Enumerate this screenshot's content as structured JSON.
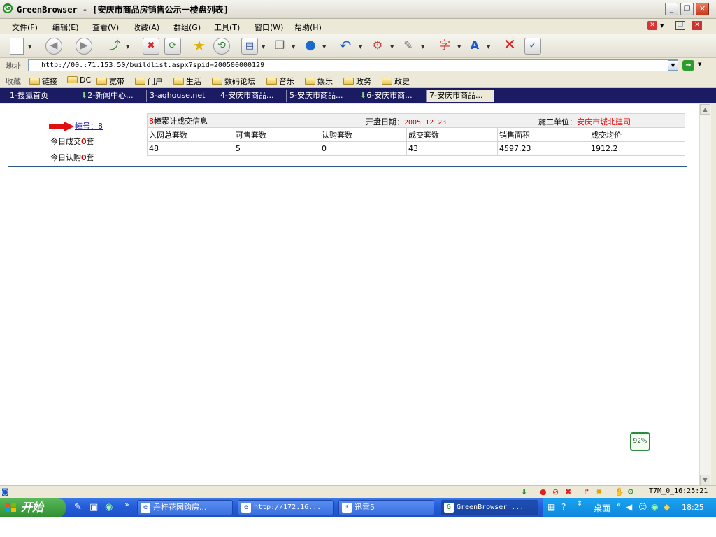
{
  "window": {
    "title": "GreenBrowser - [安庆市商品房销售公示一楼盘列表]"
  },
  "menu": {
    "items": [
      "文件(F)",
      "编辑(E)",
      "查看(V)",
      "收藏(A)",
      "群组(G)",
      "工具(T)",
      "窗口(W)",
      "帮助(H)"
    ]
  },
  "address": {
    "label": "地址",
    "url": "http://00.:71.153.50/buildlist.aspx?spid=200500000129"
  },
  "favorites": {
    "label": "收藏",
    "items": [
      "链接",
      "DC",
      "宽带",
      "门户",
      "生活",
      "数码论坛",
      "音乐",
      "娱乐",
      "政务",
      "政史"
    ]
  },
  "tabs": [
    {
      "label": "1-搜狐首页",
      "download": false
    },
    {
      "label": "2-新闻中心...",
      "download": true
    },
    {
      "label": "3-aqhouse.net",
      "download": false
    },
    {
      "label": "4-安庆市商品...",
      "download": false
    },
    {
      "label": "5-安庆市商品...",
      "download": false
    },
    {
      "label": "6-安庆市商...",
      "download": true
    },
    {
      "label": "7-安庆市商品...",
      "download": false
    }
  ],
  "listing": {
    "building_link": "幢号：8",
    "today_deal_prefix": "今日成交",
    "today_deal_count": "0",
    "today_sub_prefix": "今日认购",
    "today_sub_count": "0",
    "unit": "套",
    "info_num": "8",
    "info_title": "幢累计成交信息",
    "open_date_label": "开盘日期：",
    "open_date": "2005 12 23",
    "builder_label": "施工单位：",
    "builder": "安庆市城北建司",
    "columns": [
      "入网总套数",
      "可售套数",
      "认购套数",
      "成交套数",
      "销售面积",
      "成交均价"
    ],
    "values": [
      "48",
      "5",
      "0",
      "43",
      "4597.23",
      "1912.2"
    ]
  },
  "zoom": {
    "label": "92%"
  },
  "status": {
    "readout": "T7M_0_16:25:21"
  },
  "taskbar": {
    "start_label": "开始",
    "tasks": [
      "丹桂花园购房...",
      "http://172.16...",
      "迅雷5",
      "GreenBrowser ..."
    ],
    "tray_desktop": "桌面",
    "clock": "18:25"
  },
  "colors": {
    "tabbar": "#1b1b63",
    "accent_red": "#e00000",
    "link": "#1b1bb0",
    "taskbar": "#245edb",
    "start": "#2f8f2f"
  }
}
